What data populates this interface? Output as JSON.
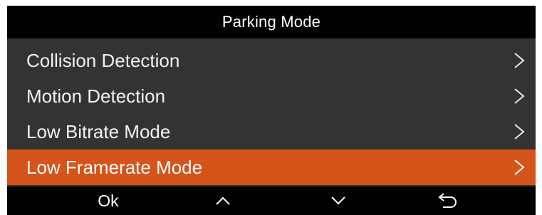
{
  "header": {
    "title": "Parking Mode"
  },
  "menu": {
    "items": [
      {
        "label": "Collision Detection",
        "icon": "chevron-right-icon",
        "selected": false
      },
      {
        "label": "Motion Detection",
        "icon": "chevron-right-icon",
        "selected": false
      },
      {
        "label": "Low Bitrate Mode",
        "icon": "chevron-right-icon",
        "selected": false
      },
      {
        "label": "Low Framerate Mode",
        "icon": "chevron-right-icon",
        "selected": true
      }
    ]
  },
  "softkeys": {
    "ok_label": "Ok",
    "up_icon": "chevron-up-icon",
    "down_icon": "chevron-down-icon",
    "back_icon": "back-arrow-icon"
  },
  "colors": {
    "screen_background": "#333333",
    "bar_background": "#000000",
    "selected_highlight": "#d4541a",
    "text": "#ffffff"
  }
}
